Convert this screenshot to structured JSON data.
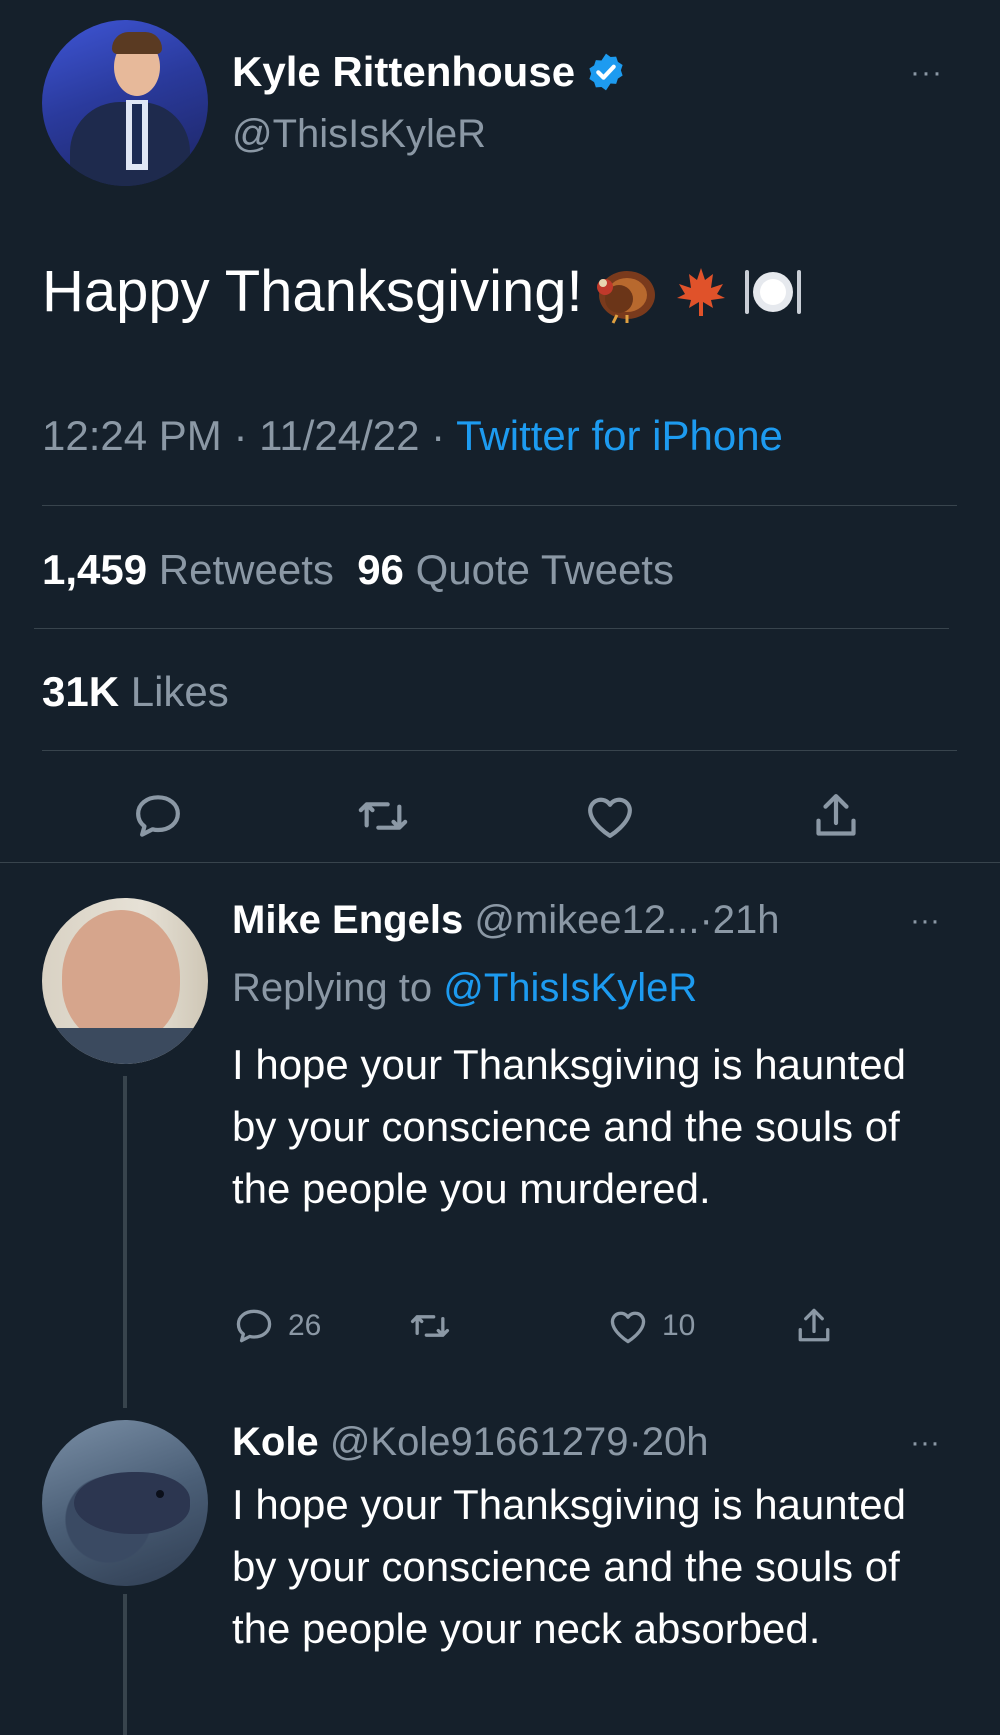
{
  "tweet": {
    "author_name": "Kyle Rittenhouse",
    "author_handle": "@ThisIsKyleR",
    "text": "Happy Thanksgiving!",
    "emojis": [
      "turkey",
      "maple-leaf",
      "plate-with-cutlery"
    ],
    "time": "12:24 PM",
    "date": "11/24/22",
    "source": "Twitter for iPhone",
    "retweets_count": "1,459",
    "retweets_label": "Retweets",
    "quotes_count": "96",
    "quotes_label": "Quote Tweets",
    "likes_count": "31K",
    "likes_label": "Likes"
  },
  "replies": [
    {
      "name": "Mike Engels",
      "handle": "@mikee12...",
      "time": "21h",
      "replying_label": "Replying to",
      "replying_to": "@ThisIsKyleR",
      "text": "I hope your Thanksgiving is haunted by your conscience and the souls of the people you murdered.",
      "reply_count": "26",
      "retweet_count": "",
      "like_count": "10"
    },
    {
      "name": "Kole",
      "handle": "@Kole91661279",
      "time": "20h",
      "text": "I hope your Thanksgiving is haunted by your conscience and the souls of the people your neck absorbed."
    }
  ],
  "ui": {
    "more_glyph": "···",
    "separator": "·"
  },
  "colors": {
    "background": "#15202b",
    "accent": "#1d9bf0",
    "secondary_text": "#8b98a5",
    "divider": "#38444d"
  }
}
